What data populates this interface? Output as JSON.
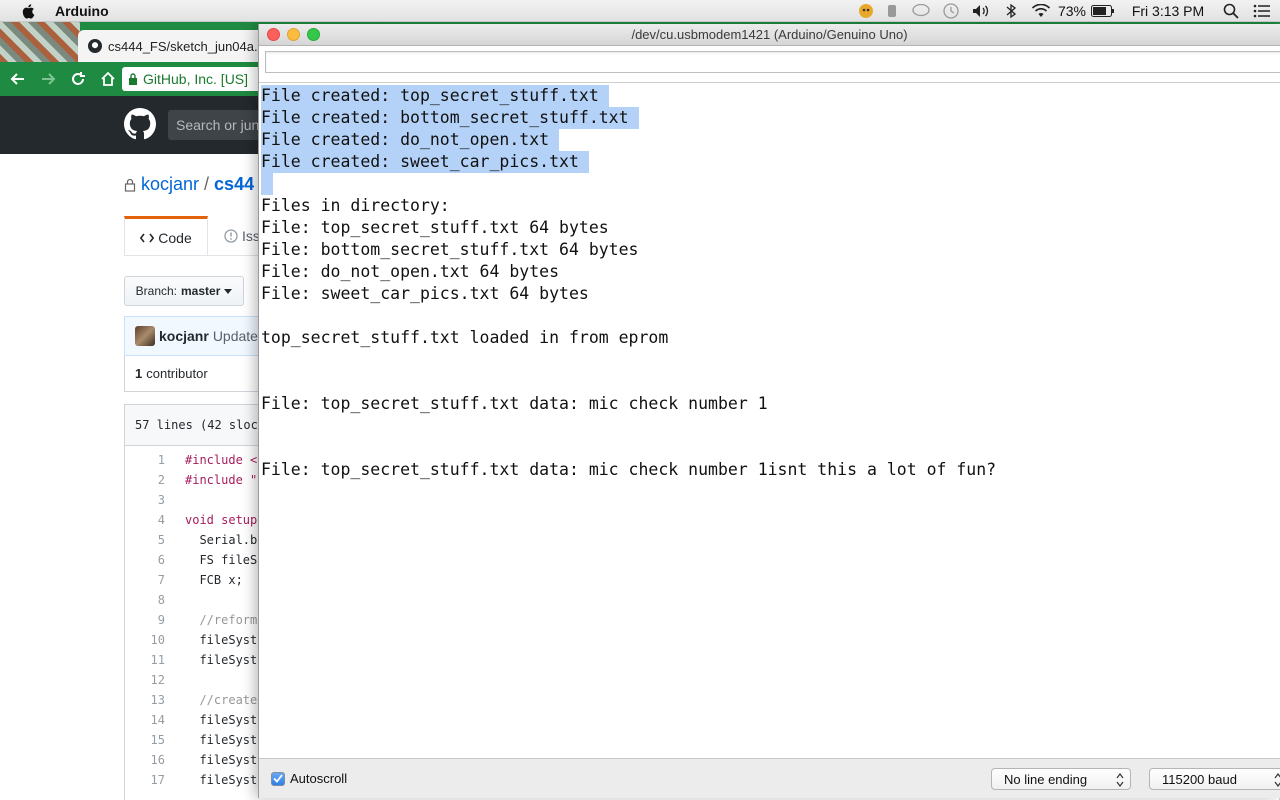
{
  "menubar": {
    "app_name": "Arduino",
    "battery_percent": "73%",
    "clock": "Fri 3:13 PM"
  },
  "chrome": {
    "tab_title": "cs444_FS/sketch_jun04a.",
    "url_text": "GitHub, Inc. [US]",
    "search_placeholder": "Search or jun",
    "repo_owner": "kocjanr",
    "repo_slash": "/",
    "repo_name": "cs44",
    "code_tab_label": "Code",
    "issues_tab_label": "Iss",
    "branch_label": "Branch:",
    "branch_value": "master",
    "commit_user": "kocjanr",
    "commit_message": "Update",
    "contributors_count": "1",
    "contributors_label": "contributor",
    "file_info": "57 lines (42 sloc",
    "code_lines": [
      {
        "n": "1",
        "t": "#include <",
        "style": "kw"
      },
      {
        "n": "2",
        "t": "#include \"",
        "style": "kw"
      },
      {
        "n": "3",
        "t": "",
        "style": ""
      },
      {
        "n": "4",
        "t": "void setup",
        "style": "kw"
      },
      {
        "n": "5",
        "t": "  Serial.b",
        "style": ""
      },
      {
        "n": "6",
        "t": "  FS fileS",
        "style": ""
      },
      {
        "n": "7",
        "t": "  FCB x;",
        "style": ""
      },
      {
        "n": "8",
        "t": "",
        "style": ""
      },
      {
        "n": "9",
        "t": "  //reforma",
        "style": "cm"
      },
      {
        "n": "10",
        "t": "  fileSyst",
        "style": ""
      },
      {
        "n": "11",
        "t": "  fileSyste",
        "style": ""
      },
      {
        "n": "12",
        "t": "",
        "style": ""
      },
      {
        "n": "13",
        "t": "  //create",
        "style": "cm"
      },
      {
        "n": "14",
        "t": "  fileSyst",
        "style": ""
      },
      {
        "n": "15",
        "t": "  fileSyst",
        "style": ""
      },
      {
        "n": "16",
        "t": "  fileSyst",
        "style": ""
      },
      {
        "n": "17",
        "t": "  fileSyst",
        "style": ""
      }
    ]
  },
  "serial": {
    "window_title": "/dev/cu.usbmodem1421 (Arduino/Genuino Uno)",
    "input_value": "",
    "output_lines": [
      {
        "text": "File created: top_secret_stuff.txt ",
        "selected": true
      },
      {
        "text": "File created: bottom_secret_stuff.txt ",
        "selected": true
      },
      {
        "text": "File created: do_not_open.txt ",
        "selected": true
      },
      {
        "text": "File created: sweet_car_pics.txt ",
        "selected": true
      },
      {
        "text": "",
        "selected": true
      },
      {
        "text": "Files in directory:",
        "selected": false
      },
      {
        "text": "File: top_secret_stuff.txt 64 bytes",
        "selected": false
      },
      {
        "text": "File: bottom_secret_stuff.txt 64 bytes",
        "selected": false
      },
      {
        "text": "File: do_not_open.txt 64 bytes",
        "selected": false
      },
      {
        "text": "File: sweet_car_pics.txt 64 bytes",
        "selected": false
      },
      {
        "text": "",
        "selected": false
      },
      {
        "text": "top_secret_stuff.txt loaded in from eprom",
        "selected": false
      },
      {
        "text": "",
        "selected": false
      },
      {
        "text": "",
        "selected": false
      },
      {
        "text": "File: top_secret_stuff.txt data: mic check number 1",
        "selected": false
      },
      {
        "text": "",
        "selected": false
      },
      {
        "text": "",
        "selected": false
      },
      {
        "text": "File: top_secret_stuff.txt data: mic check number 1isnt this a lot of fun?",
        "selected": false
      }
    ],
    "autoscroll_label": "Autoscroll",
    "autoscroll_checked": true,
    "line_ending": "No line ending",
    "baud_rate": "115200 baud"
  }
}
